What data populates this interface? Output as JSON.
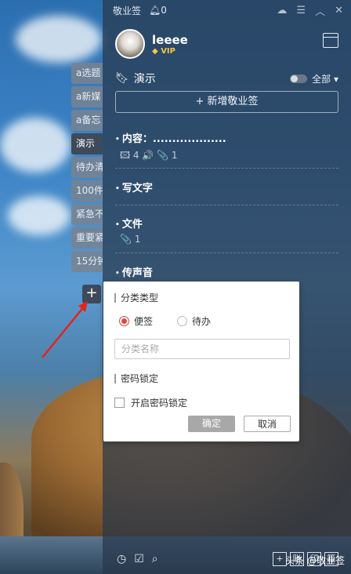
{
  "app": {
    "title": "敬业签",
    "notif_count": "0"
  },
  "user": {
    "name": "leeee",
    "badge": "VIP"
  },
  "category": {
    "current": "演示",
    "filter": "全部"
  },
  "new_button": "新增敬业签",
  "side_tabs": [
    "a选题",
    "a新媒",
    "a备忘",
    "演示",
    "待办清",
    "100件",
    "紧急不",
    "重要紧",
    "15分钟"
  ],
  "add_tab": "+",
  "notes": [
    {
      "title": "内容：...................",
      "meta": "🖾 4  🔊  📎 1"
    },
    {
      "title": "写文字",
      "meta": ""
    },
    {
      "title": "文件",
      "meta": "📎 1"
    },
    {
      "title": "传声音",
      "meta": ""
    }
  ],
  "dialog": {
    "type_label": "分类类型",
    "option_note": "便签",
    "option_todo": "待办",
    "name_placeholder": "分类名称",
    "lock_label": "密码锁定",
    "lock_checkbox": "开启密码锁定",
    "confirm": "确定",
    "cancel": "取消"
  },
  "bottom": {
    "right_buttons": [
      "+",
      "账",
      "印",
      "篇"
    ]
  },
  "watermark": "头条 @敬业签"
}
